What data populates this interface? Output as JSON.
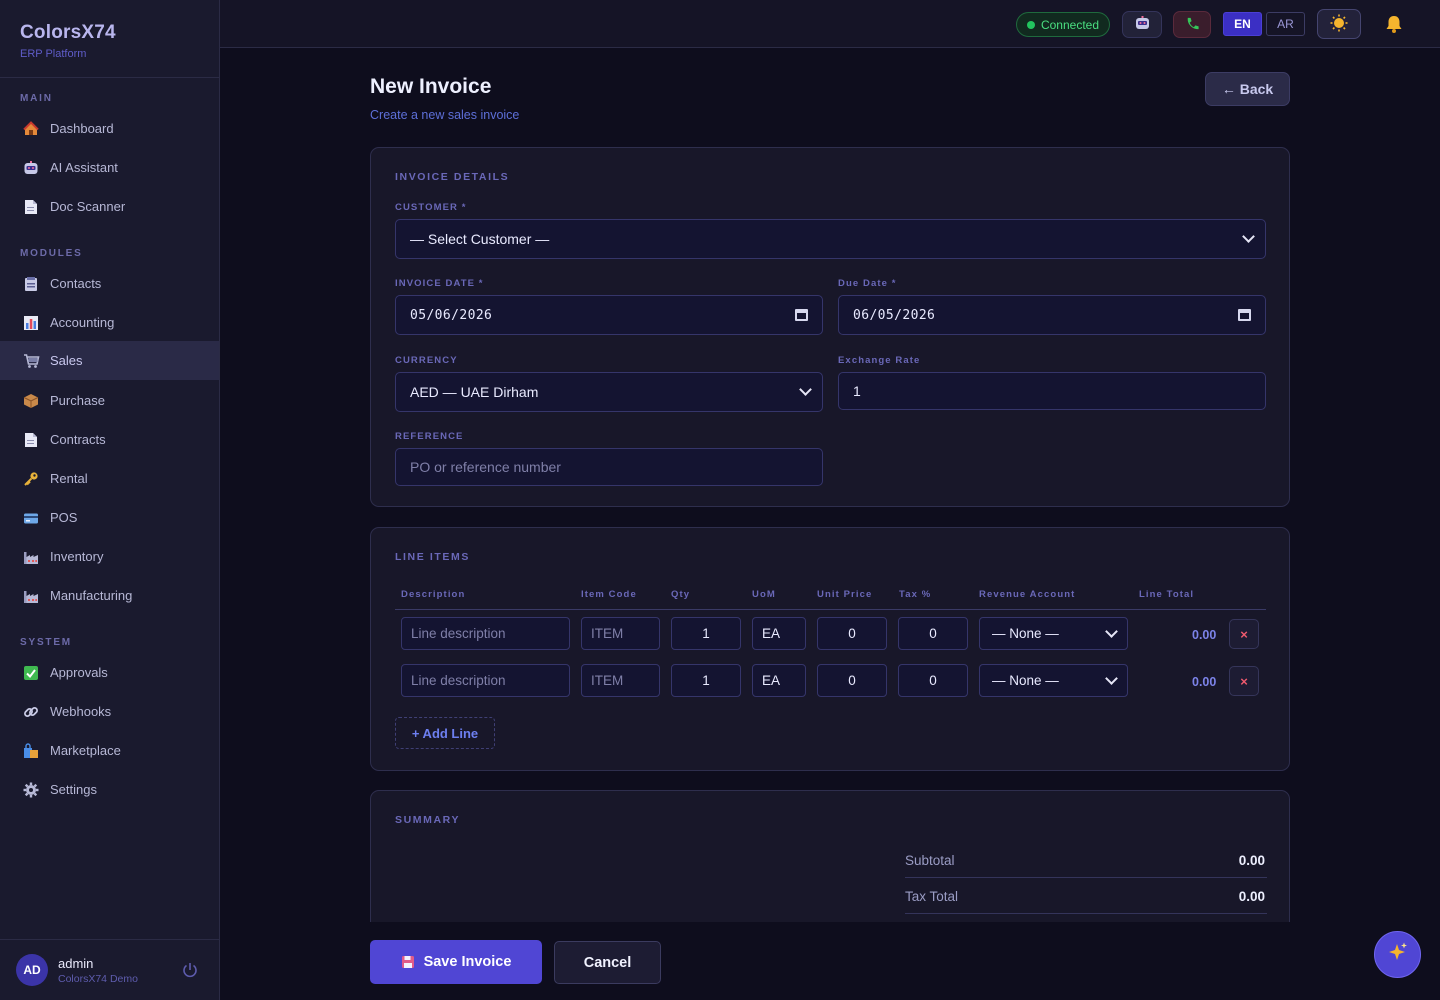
{
  "brand": {
    "name": "ColorsX74",
    "subtitle": "ERP Platform"
  },
  "sidebar": {
    "sections": {
      "main": "MAIN",
      "modules": "MODULES",
      "system": "SYSTEM"
    },
    "main_items": [
      {
        "label": "Dashboard",
        "icon": "house-icon"
      },
      {
        "label": "AI Assistant",
        "icon": "robot-icon"
      },
      {
        "label": "Doc Scanner",
        "icon": "document-icon"
      }
    ],
    "module_items": [
      {
        "label": "Contacts",
        "icon": "address-book-icon"
      },
      {
        "label": "Accounting",
        "icon": "bar-chart-icon"
      },
      {
        "label": "Sales",
        "icon": "cart-icon",
        "active": true
      },
      {
        "label": "Purchase",
        "icon": "package-icon"
      },
      {
        "label": "Contracts",
        "icon": "document-icon"
      },
      {
        "label": "Rental",
        "icon": "key-icon"
      },
      {
        "label": "POS",
        "icon": "credit-card-icon"
      },
      {
        "label": "Inventory",
        "icon": "factory-icon"
      },
      {
        "label": "Manufacturing",
        "icon": "factory-icon"
      }
    ],
    "system_items": [
      {
        "label": "Approvals",
        "icon": "check-box-icon"
      },
      {
        "label": "Webhooks",
        "icon": "link-icon"
      },
      {
        "label": "Marketplace",
        "icon": "shopping-bags-icon"
      },
      {
        "label": "Settings",
        "icon": "gear-icon"
      }
    ]
  },
  "user": {
    "initials": "AD",
    "name": "admin",
    "org": "ColorsX74 Demo"
  },
  "topbar": {
    "status": "Connected",
    "lang_en": "EN",
    "lang_ar": "AR"
  },
  "page": {
    "title": "New Invoice",
    "subtitle": "Create a new sales invoice",
    "back_label": "← Back"
  },
  "invoice_details": {
    "title": "INVOICE DETAILS",
    "customer_label": "CUSTOMER *",
    "customer_value": "— Select Customer —",
    "invoice_date_label": "INVOICE DATE *",
    "invoice_date_value": "05/06/2026",
    "due_date_label": "Due Date *",
    "due_date_value": "06/05/2026",
    "currency_label": "CURRENCY",
    "currency_value": "AED — UAE Dirham",
    "exchange_label": "Exchange Rate",
    "exchange_value": "1",
    "reference_label": "REFERENCE",
    "reference_placeholder": "PO or reference number"
  },
  "line_items": {
    "title": "LINE ITEMS",
    "headers": [
      "Description",
      "Item Code",
      "Qty",
      "UoM",
      "Unit Price",
      "Tax %",
      "Revenue Account",
      "Line Total"
    ],
    "rows": [
      {
        "description_ph": "Line description",
        "item_code_ph": "ITEM",
        "qty": "1",
        "uom": "EA",
        "unit_price": "0",
        "tax": "0",
        "account": "— None —",
        "total": "0.00"
      },
      {
        "description_ph": "Line description",
        "item_code_ph": "ITEM",
        "qty": "1",
        "uom": "EA",
        "unit_price": "0",
        "tax": "0",
        "account": "— None —",
        "total": "0.00"
      }
    ],
    "add_label": "+ Add Line",
    "delete_label": "×"
  },
  "summary": {
    "title": "SUMMARY",
    "subtotal_label": "Subtotal",
    "subtotal_value": "0.00",
    "tax_label": "Tax Total",
    "tax_value": "0.00"
  },
  "actions": {
    "save_label": "Save Invoice",
    "cancel_label": "Cancel"
  }
}
